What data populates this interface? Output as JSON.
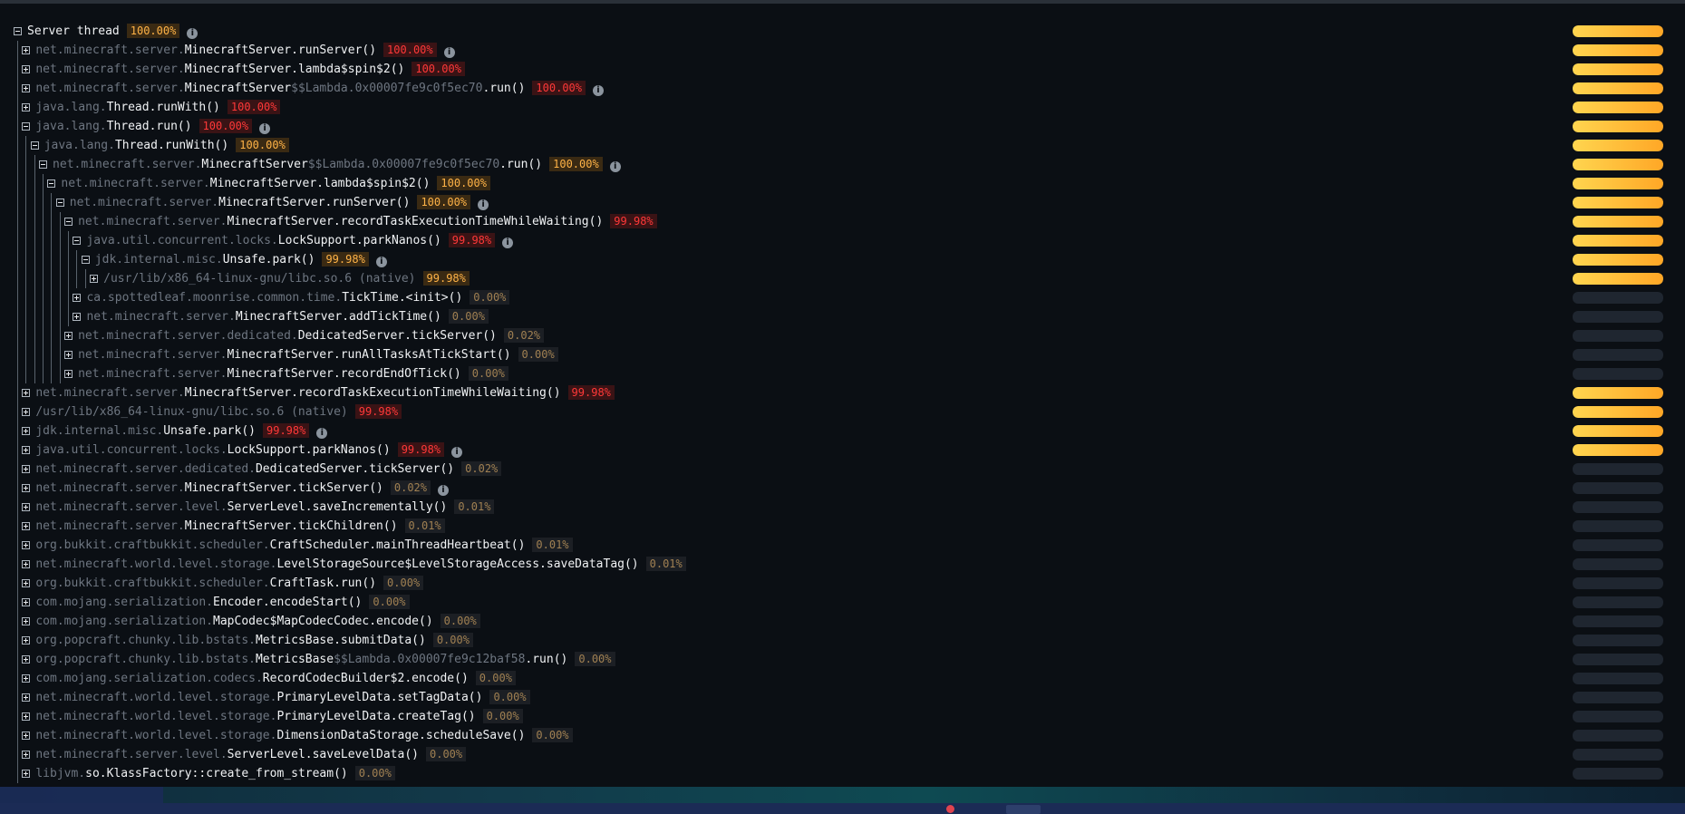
{
  "colors": {
    "background": "#0b0f14",
    "hot": "#ff3838",
    "warm": "#ffb347",
    "bar_gradient": [
      "#ffd54f",
      "#ffa726"
    ],
    "bar_track": "#1f2630"
  },
  "icons": {
    "expand": "plus-square-icon",
    "collapse": "minus-square-icon",
    "info": "info-circle-icon"
  },
  "rows": [
    {
      "depth": 0,
      "open": true,
      "pkg": "",
      "cls": "Server thread",
      "lam": "",
      "mth": "",
      "native": "",
      "pct": "100.00%",
      "heat": "warm",
      "info": true,
      "bar": 1
    },
    {
      "depth": 1,
      "open": false,
      "pkg": "net.minecraft.server.",
      "cls": "MinecraftServer",
      "lam": "",
      "mth": ".runServer()",
      "native": "",
      "pct": "100.00%",
      "heat": "hot",
      "info": true,
      "bar": 1
    },
    {
      "depth": 1,
      "open": false,
      "pkg": "net.minecraft.server.",
      "cls": "MinecraftServer",
      "lam": "",
      "mth": ".lambda$spin$2()",
      "native": "",
      "pct": "100.00%",
      "heat": "hot",
      "info": false,
      "bar": 1
    },
    {
      "depth": 1,
      "open": false,
      "pkg": "net.minecraft.server.",
      "cls": "MinecraftServer",
      "lam": "$$Lambda.0x00007fe9c0f5ec70",
      "mth": ".run()",
      "native": "",
      "pct": "100.00%",
      "heat": "hot",
      "info": true,
      "bar": 1
    },
    {
      "depth": 1,
      "open": false,
      "pkg": "java.lang.",
      "cls": "Thread",
      "lam": "",
      "mth": ".runWith()",
      "native": "",
      "pct": "100.00%",
      "heat": "hot",
      "info": false,
      "bar": 1
    },
    {
      "depth": 1,
      "open": true,
      "pkg": "java.lang.",
      "cls": "Thread",
      "lam": "",
      "mth": ".run()",
      "native": "",
      "pct": "100.00%",
      "heat": "hot",
      "info": true,
      "bar": 1
    },
    {
      "depth": 2,
      "open": true,
      "pkg": "java.lang.",
      "cls": "Thread",
      "lam": "",
      "mth": ".runWith()",
      "native": "",
      "pct": "100.00%",
      "heat": "warm",
      "info": false,
      "bar": 1
    },
    {
      "depth": 3,
      "open": true,
      "pkg": "net.minecraft.server.",
      "cls": "MinecraftServer",
      "lam": "$$Lambda.0x00007fe9c0f5ec70",
      "mth": ".run()",
      "native": "",
      "pct": "100.00%",
      "heat": "warm",
      "info": true,
      "bar": 1
    },
    {
      "depth": 4,
      "open": true,
      "pkg": "net.minecraft.server.",
      "cls": "MinecraftServer",
      "lam": "",
      "mth": ".lambda$spin$2()",
      "native": "",
      "pct": "100.00%",
      "heat": "warm",
      "info": false,
      "bar": 1
    },
    {
      "depth": 5,
      "open": true,
      "pkg": "net.minecraft.server.",
      "cls": "MinecraftServer",
      "lam": "",
      "mth": ".runServer()",
      "native": "",
      "pct": "100.00%",
      "heat": "warm",
      "info": true,
      "bar": 1
    },
    {
      "depth": 6,
      "open": true,
      "pkg": "net.minecraft.server.",
      "cls": "MinecraftServer",
      "lam": "",
      "mth": ".recordTaskExecutionTimeWhileWaiting()",
      "native": "",
      "pct": "99.98%",
      "heat": "hot",
      "info": false,
      "bar": 0.9998
    },
    {
      "depth": 7,
      "open": true,
      "pkg": "java.util.concurrent.locks.",
      "cls": "LockSupport",
      "lam": "",
      "mth": ".parkNanos()",
      "native": "",
      "pct": "99.98%",
      "heat": "hot",
      "info": true,
      "bar": 0.9998
    },
    {
      "depth": 8,
      "open": true,
      "pkg": "jdk.internal.misc.",
      "cls": "Unsafe",
      "lam": "",
      "mth": ".park()",
      "native": "",
      "pct": "99.98%",
      "heat": "warm",
      "info": true,
      "bar": 0.9998
    },
    {
      "depth": 9,
      "open": false,
      "pkg": "",
      "cls": "",
      "lam": "",
      "mth": "",
      "native": "/usr/lib/x86_64-linux-gnu/libc.so.6 (native)",
      "pct": "99.98%",
      "heat": "warm",
      "info": false,
      "bar": 0.9998
    },
    {
      "depth": 7,
      "open": false,
      "pkg": "ca.spottedleaf.moonrise.common.time.",
      "cls": "TickTime",
      "lam": "",
      "mth": ".<init>()",
      "native": "",
      "pct": "0.00%",
      "heat": "cold",
      "info": false,
      "bar": 0
    },
    {
      "depth": 7,
      "open": false,
      "pkg": "net.minecraft.server.",
      "cls": "MinecraftServer",
      "lam": "",
      "mth": ".addTickTime()",
      "native": "",
      "pct": "0.00%",
      "heat": "cold",
      "info": false,
      "bar": 0
    },
    {
      "depth": 6,
      "open": false,
      "pkg": "net.minecraft.server.dedicated.",
      "cls": "DedicatedServer",
      "lam": "",
      "mth": ".tickServer()",
      "native": "",
      "pct": "0.02%",
      "heat": "cold",
      "info": false,
      "bar": 0
    },
    {
      "depth": 6,
      "open": false,
      "pkg": "net.minecraft.server.",
      "cls": "MinecraftServer",
      "lam": "",
      "mth": ".runAllTasksAtTickStart()",
      "native": "",
      "pct": "0.00%",
      "heat": "cold",
      "info": false,
      "bar": 0
    },
    {
      "depth": 6,
      "open": false,
      "pkg": "net.minecraft.server.",
      "cls": "MinecraftServer",
      "lam": "",
      "mth": ".recordEndOfTick()",
      "native": "",
      "pct": "0.00%",
      "heat": "cold",
      "info": false,
      "bar": 0
    },
    {
      "depth": 1,
      "open": false,
      "pkg": "net.minecraft.server.",
      "cls": "MinecraftServer",
      "lam": "",
      "mth": ".recordTaskExecutionTimeWhileWaiting()",
      "native": "",
      "pct": "99.98%",
      "heat": "hot",
      "info": false,
      "bar": 0.9998
    },
    {
      "depth": 1,
      "open": false,
      "pkg": "",
      "cls": "",
      "lam": "",
      "mth": "",
      "native": "/usr/lib/x86_64-linux-gnu/libc.so.6 (native)",
      "pct": "99.98%",
      "heat": "hot",
      "info": false,
      "bar": 0.9998
    },
    {
      "depth": 1,
      "open": false,
      "pkg": "jdk.internal.misc.",
      "cls": "Unsafe",
      "lam": "",
      "mth": ".park()",
      "native": "",
      "pct": "99.98%",
      "heat": "hot",
      "info": true,
      "bar": 0.9998
    },
    {
      "depth": 1,
      "open": false,
      "pkg": "java.util.concurrent.locks.",
      "cls": "LockSupport",
      "lam": "",
      "mth": ".parkNanos()",
      "native": "",
      "pct": "99.98%",
      "heat": "hot",
      "info": true,
      "bar": 0.9998
    },
    {
      "depth": 1,
      "open": false,
      "pkg": "net.minecraft.server.dedicated.",
      "cls": "DedicatedServer",
      "lam": "",
      "mth": ".tickServer()",
      "native": "",
      "pct": "0.02%",
      "heat": "cold",
      "info": false,
      "bar": 0
    },
    {
      "depth": 1,
      "open": false,
      "pkg": "net.minecraft.server.",
      "cls": "MinecraftServer",
      "lam": "",
      "mth": ".tickServer()",
      "native": "",
      "pct": "0.02%",
      "heat": "cold",
      "info": true,
      "bar": 0
    },
    {
      "depth": 1,
      "open": false,
      "pkg": "net.minecraft.server.level.",
      "cls": "ServerLevel",
      "lam": "",
      "mth": ".saveIncrementally()",
      "native": "",
      "pct": "0.01%",
      "heat": "cold",
      "info": false,
      "bar": 0
    },
    {
      "depth": 1,
      "open": false,
      "pkg": "net.minecraft.server.",
      "cls": "MinecraftServer",
      "lam": "",
      "mth": ".tickChildren()",
      "native": "",
      "pct": "0.01%",
      "heat": "cold",
      "info": false,
      "bar": 0
    },
    {
      "depth": 1,
      "open": false,
      "pkg": "org.bukkit.craftbukkit.scheduler.",
      "cls": "CraftScheduler",
      "lam": "",
      "mth": ".mainThreadHeartbeat()",
      "native": "",
      "pct": "0.01%",
      "heat": "cold",
      "info": false,
      "bar": 0
    },
    {
      "depth": 1,
      "open": false,
      "pkg": "net.minecraft.world.level.storage.",
      "cls": "LevelStorageSource$LevelStorageAccess",
      "lam": "",
      "mth": ".saveDataTag()",
      "native": "",
      "pct": "0.01%",
      "heat": "cold",
      "info": false,
      "bar": 0
    },
    {
      "depth": 1,
      "open": false,
      "pkg": "org.bukkit.craftbukkit.scheduler.",
      "cls": "CraftTask",
      "lam": "",
      "mth": ".run()",
      "native": "",
      "pct": "0.00%",
      "heat": "cold",
      "info": false,
      "bar": 0
    },
    {
      "depth": 1,
      "open": false,
      "pkg": "com.mojang.serialization.",
      "cls": "Encoder",
      "lam": "",
      "mth": ".encodeStart()",
      "native": "",
      "pct": "0.00%",
      "heat": "cold",
      "info": false,
      "bar": 0
    },
    {
      "depth": 1,
      "open": false,
      "pkg": "com.mojang.serialization.",
      "cls": "MapCodec$MapCodecCodec",
      "lam": "",
      "mth": ".encode()",
      "native": "",
      "pct": "0.00%",
      "heat": "cold",
      "info": false,
      "bar": 0
    },
    {
      "depth": 1,
      "open": false,
      "pkg": "org.popcraft.chunky.lib.bstats.",
      "cls": "MetricsBase",
      "lam": "",
      "mth": ".submitData()",
      "native": "",
      "pct": "0.00%",
      "heat": "cold",
      "info": false,
      "bar": 0
    },
    {
      "depth": 1,
      "open": false,
      "pkg": "org.popcraft.chunky.lib.bstats.",
      "cls": "MetricsBase",
      "lam": "$$Lambda.0x00007fe9c12baf58",
      "mth": ".run()",
      "native": "",
      "pct": "0.00%",
      "heat": "cold",
      "info": false,
      "bar": 0
    },
    {
      "depth": 1,
      "open": false,
      "pkg": "com.mojang.serialization.codecs.",
      "cls": "RecordCodecBuilder$2",
      "lam": "",
      "mth": ".encode()",
      "native": "",
      "pct": "0.00%",
      "heat": "cold",
      "info": false,
      "bar": 0
    },
    {
      "depth": 1,
      "open": false,
      "pkg": "net.minecraft.world.level.storage.",
      "cls": "PrimaryLevelData",
      "lam": "",
      "mth": ".setTagData()",
      "native": "",
      "pct": "0.00%",
      "heat": "cold",
      "info": false,
      "bar": 0
    },
    {
      "depth": 1,
      "open": false,
      "pkg": "net.minecraft.world.level.storage.",
      "cls": "PrimaryLevelData",
      "lam": "",
      "mth": ".createTag()",
      "native": "",
      "pct": "0.00%",
      "heat": "cold",
      "info": false,
      "bar": 0
    },
    {
      "depth": 1,
      "open": false,
      "pkg": "net.minecraft.world.level.storage.",
      "cls": "DimensionDataStorage",
      "lam": "",
      "mth": ".scheduleSave()",
      "native": "",
      "pct": "0.00%",
      "heat": "cold",
      "info": false,
      "bar": 0
    },
    {
      "depth": 1,
      "open": false,
      "pkg": "net.minecraft.server.level.",
      "cls": "ServerLevel",
      "lam": "",
      "mth": ".saveLevelData()",
      "native": "",
      "pct": "0.00%",
      "heat": "cold",
      "info": false,
      "bar": 0
    },
    {
      "depth": 1,
      "open": false,
      "pkg": "libjvm.",
      "cls": "so.KlassFactory",
      "lam": "",
      "mth": "::create_from_stream()",
      "native": "",
      "pct": "0.00%",
      "heat": "cold",
      "info": false,
      "bar": 0
    }
  ]
}
